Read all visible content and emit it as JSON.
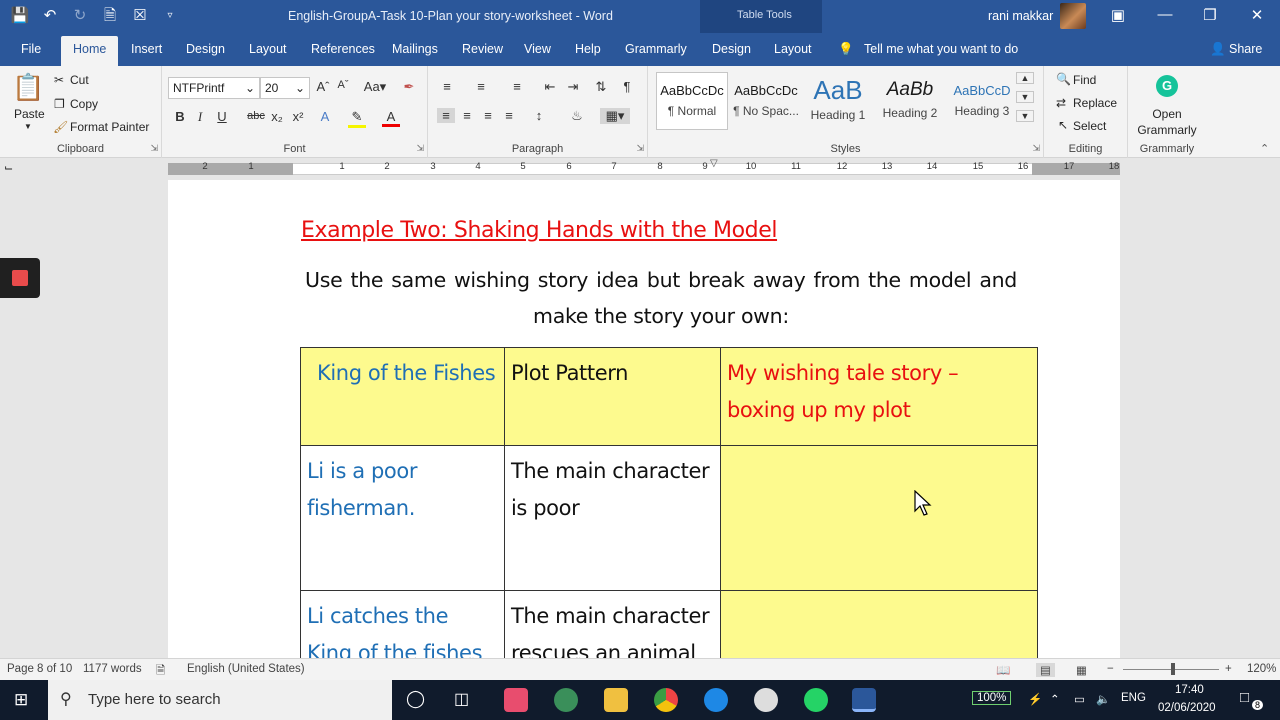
{
  "window": {
    "title": "English-GroupA-Task 10-Plan your story-worksheet  -  Word",
    "context_tab_group": "Table Tools",
    "user": "rani makkar"
  },
  "tabs": [
    "File",
    "Home",
    "Insert",
    "Design",
    "Layout",
    "References",
    "Mailings",
    "Review",
    "View",
    "Help",
    "Grammarly",
    "Design",
    "Layout"
  ],
  "tell_me": "Tell me what you want to do",
  "share": "Share",
  "ribbon": {
    "clipboard": {
      "label": "Clipboard",
      "paste": "Paste",
      "cut": "Cut",
      "copy": "Copy",
      "format_painter": "Format Painter"
    },
    "font": {
      "label": "Font",
      "font_name": "NTFPrintf",
      "font_size": "20"
    },
    "paragraph": {
      "label": "Paragraph"
    },
    "styles": {
      "label": "Styles",
      "items": [
        {
          "preview": "AaBbCcDc",
          "name": "¶ Normal"
        },
        {
          "preview": "AaBbCcDc",
          "name": "¶ No Spac..."
        },
        {
          "preview": "AaB",
          "name": "Heading 1"
        },
        {
          "preview": "AaBb",
          "name": "Heading 2"
        },
        {
          "preview": "AaBbCcD",
          "name": "Heading 3"
        }
      ]
    },
    "editing": {
      "label": "Editing",
      "find": "Find",
      "replace": "Replace",
      "select": "Select"
    },
    "grammarly": {
      "label": "Grammarly",
      "open": "Open Grammarly"
    }
  },
  "ruler_numbers": [
    "2",
    "1",
    "1",
    "2",
    "3",
    "4",
    "5",
    "6",
    "7",
    "8",
    "9",
    "10",
    "11",
    "12",
    "13",
    "14",
    "15",
    "16",
    "17",
    "18"
  ],
  "document": {
    "heading": "Example Two: Shaking Hands with the Model",
    "paragraph": "Use the same wishing story idea but break away from the model and make the story your own:",
    "table": {
      "headers": [
        "King of the Fishes",
        "Plot Pattern",
        "My wishing tale story – boxing up my plot"
      ],
      "rows": [
        [
          "Li is a poor fisherman.",
          "The main character is poor",
          ""
        ],
        [
          "Li catches the King of the fishes but",
          "The main character rescues an animal",
          ""
        ]
      ]
    }
  },
  "status": {
    "page": "Page 8 of 10",
    "words": "1177 words",
    "language": "English (United States)",
    "zoom": "120%"
  },
  "taskbar": {
    "search_placeholder": "Type here to search",
    "battery": "100%",
    "lang": "ENG",
    "time": "17:40",
    "date": "02/06/2020",
    "notifications": "8"
  }
}
